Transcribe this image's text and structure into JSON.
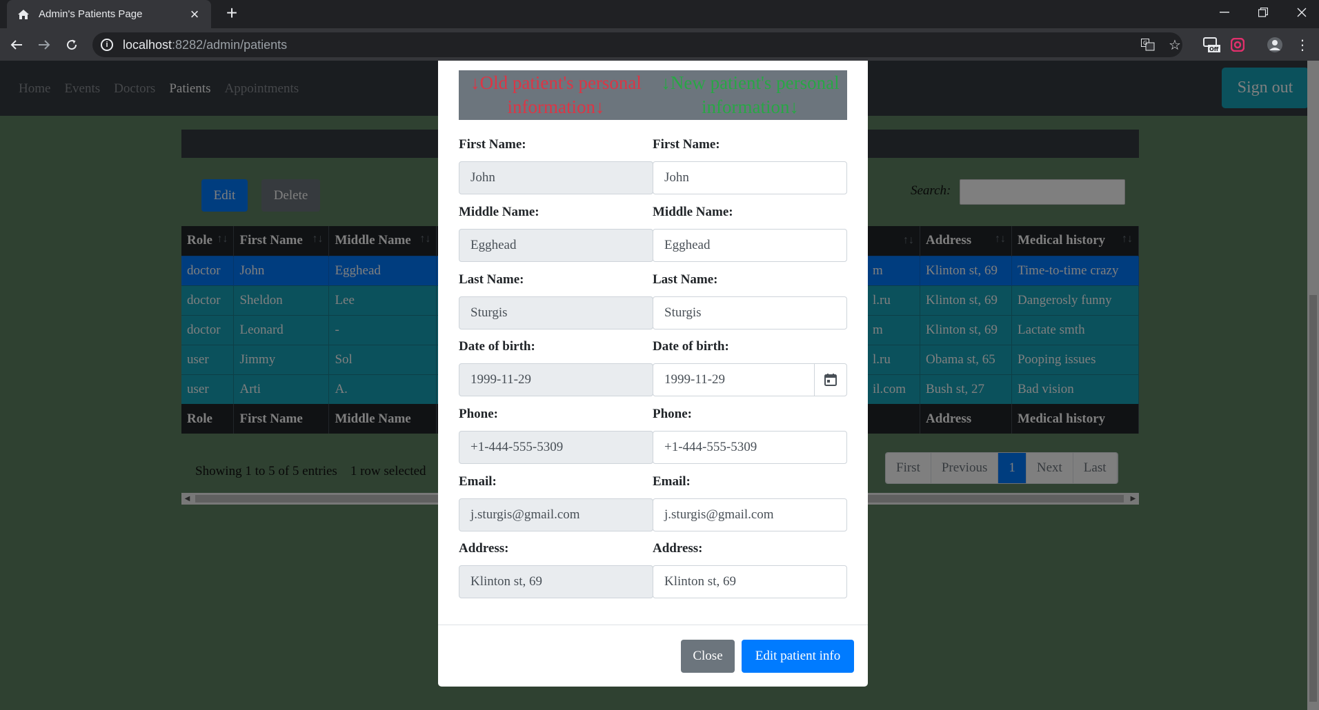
{
  "browser": {
    "tab_title": "Admin's Patients Page",
    "url_host": "localhost",
    "url_path": ":8282/admin/patients"
  },
  "nav": {
    "links": [
      "Home",
      "Events",
      "Doctors",
      "Patients",
      "Appointments"
    ],
    "active": "Patients",
    "sign_out": "Sign out"
  },
  "toolbar": {
    "edit_label": "Edit",
    "delete_label": "Delete",
    "search_label": "Search:"
  },
  "table": {
    "left_columns": [
      "Role",
      "First Name",
      "Middle Name"
    ],
    "right_columns": [
      "",
      "Address",
      "Medical history"
    ],
    "rows": [
      {
        "role": "doctor",
        "first": "John",
        "middle": "Egghead",
        "email_tail": "m",
        "address": "Klinton st, 69",
        "history": "Time-to-time crazy",
        "selected": true
      },
      {
        "role": "doctor",
        "first": "Sheldon",
        "middle": "Lee",
        "email_tail": "l.ru",
        "address": "Klinton st, 69",
        "history": "Dangerosly funny",
        "selected": false
      },
      {
        "role": "doctor",
        "first": "Leonard",
        "middle": "-",
        "email_tail": "m",
        "address": "Klinton st, 69",
        "history": "Lactate smth",
        "selected": false
      },
      {
        "role": "user",
        "first": "Jimmy",
        "middle": "Sol",
        "email_tail": "l.ru",
        "address": "Obama st, 65",
        "history": "Pooping issues",
        "selected": false
      },
      {
        "role": "user",
        "first": "Arti",
        "middle": "A.",
        "email_tail": "il.com",
        "address": "Bush st, 27",
        "history": "Bad vision",
        "selected": false
      }
    ]
  },
  "footer": {
    "showing": "Showing 1 to 5 of 5 entries",
    "selected": "1 row selected",
    "pager": [
      "First",
      "Previous",
      "1",
      "Next",
      "Last"
    ],
    "current_page": "1"
  },
  "modal": {
    "legend_old": "↓Old patient's personal information↓",
    "legend_new": "↓New patient's personal information↓",
    "fields": [
      {
        "label": "First Name:",
        "old": "John",
        "new": "John"
      },
      {
        "label": "Middle Name:",
        "old": "Egghead",
        "new": "Egghead"
      },
      {
        "label": "Last Name:",
        "old": "Sturgis",
        "new": "Sturgis"
      },
      {
        "label": "Date of birth:",
        "old": "1999-11-29",
        "new": "1999-11-29"
      },
      {
        "label": "Phone:",
        "old": "+1-444-555-5309",
        "new": "+1-444-555-5309"
      },
      {
        "label": "Email:",
        "old": "j.sturgis@gmail.com",
        "new": "j.sturgis@gmail.com"
      },
      {
        "label": "Address:",
        "old": "Klinton st, 69",
        "new": "Klinton st, 69"
      }
    ],
    "close_label": "Close",
    "submit_label": "Edit patient info"
  },
  "colors": {
    "page_bg": "#5e8262",
    "navbar": "#343a40",
    "primary": "#007bff",
    "info": "#17a2b8",
    "secondary": "#6c757d",
    "danger": "#dc3545",
    "success": "#28a745"
  }
}
